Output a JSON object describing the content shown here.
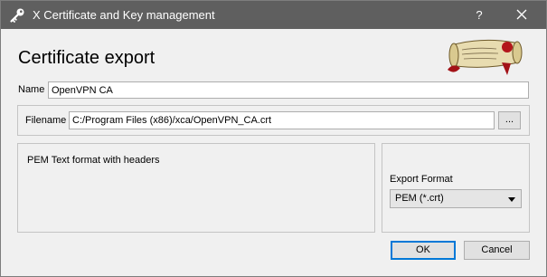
{
  "window": {
    "title": "X Certificate and Key management",
    "help_label": "?"
  },
  "dialog": {
    "heading": "Certificate export",
    "name_label": "Name",
    "name_value": "OpenVPN CA",
    "filename_label": "Filename",
    "filename_value": "C:/Program Files (x86)/xca/OpenVPN_CA.crt",
    "browse_label": "...",
    "format_description": "PEM Text format with headers",
    "export_format_label": "Export Format",
    "export_format_selected": "PEM (*.crt)",
    "ok_label": "OK",
    "cancel_label": "Cancel"
  },
  "icons": {
    "title": "key-icon",
    "close": "close-icon",
    "logo": "xca-scroll-logo",
    "dropdown": "chevron-down-icon"
  },
  "colors": {
    "titlebar": "#5f5f5f",
    "background": "#f0f0f0",
    "default_button_border": "#0078d7"
  }
}
